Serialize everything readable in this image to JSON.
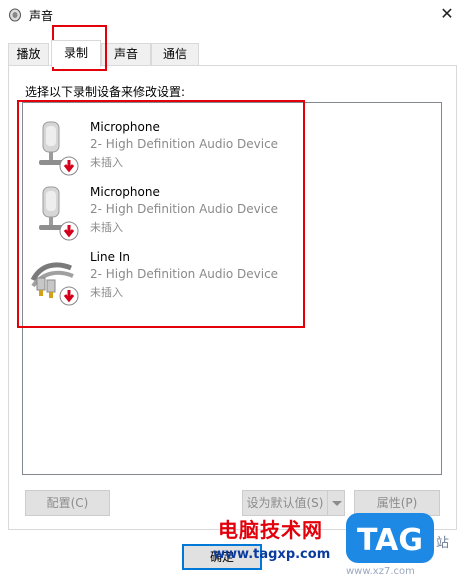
{
  "window": {
    "title": "声音"
  },
  "tabs": [
    {
      "label": "播放"
    },
    {
      "label": "录制"
    },
    {
      "label": "声音"
    },
    {
      "label": "通信"
    }
  ],
  "instruction": "选择以下录制设备来修改设置:",
  "devices": [
    {
      "name": "Microphone",
      "driver": "2- High Definition Audio Device",
      "state": "未插入",
      "icon": "microphone-icon"
    },
    {
      "name": "Microphone",
      "driver": "2- High Definition Audio Device",
      "state": "未插入",
      "icon": "microphone-icon"
    },
    {
      "name": "Line In",
      "driver": "2- High Definition Audio Device",
      "state": "未插入",
      "icon": "line-in-cable-icon"
    }
  ],
  "buttons": {
    "configure": "配置(C)",
    "set_default": "设为默认值(S)",
    "properties": "属性(P)",
    "ok": "确定"
  },
  "watermark": {
    "text": "电脑技术网",
    "url": "www.tagxp.com",
    "logo": "TAG",
    "side": "站",
    "sub": "www.xz7.com"
  },
  "colors": {
    "highlight": "#e3000b",
    "accent": "#0078d7",
    "logo": "#1e88e5"
  }
}
